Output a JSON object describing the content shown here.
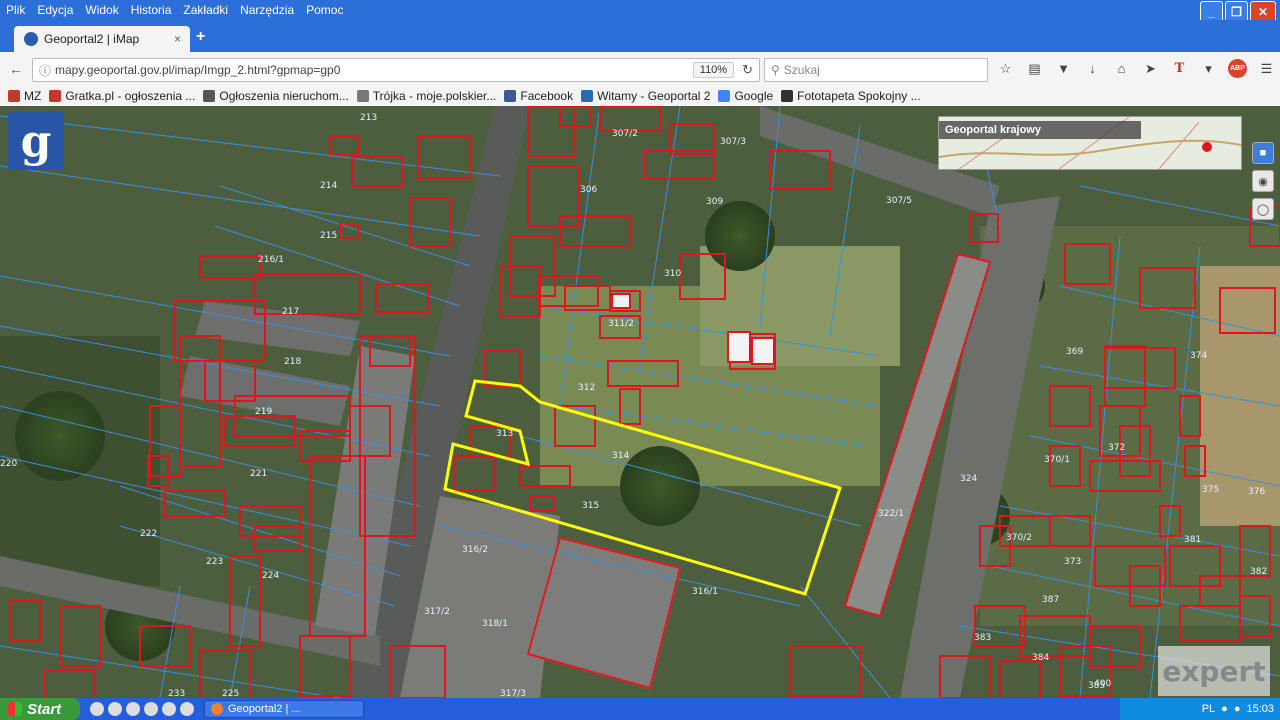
{
  "menu": [
    "Plik",
    "Edycja",
    "Widok",
    "Historia",
    "Zakładki",
    "Narzędzia",
    "Pomoc"
  ],
  "window_controls": {
    "minimize": "_",
    "maximize": "❐",
    "close": "✕"
  },
  "tab": {
    "title": "Geoportal2 | iMap",
    "close": "×",
    "new": "+"
  },
  "navbar": {
    "url": "mapy.geoportal.gov.pl/imap/Imgp_2.html?gpmap=gp0",
    "zoom": "110%",
    "search_placeholder": "Szukaj"
  },
  "bookmarks": [
    {
      "label": "MZ",
      "color": "#c0392b"
    },
    {
      "label": "Gratka.pl - ogłoszenia ...",
      "color": "#c0392b"
    },
    {
      "label": "Ogłoszenia nieruchom...",
      "color": "#555555"
    },
    {
      "label": "Trójka - moje.polskier...",
      "color": "#777777"
    },
    {
      "label": "Facebook",
      "color": "#3b5998"
    },
    {
      "label": "Witamy - Geoportal 2",
      "color": "#2a6ab0"
    },
    {
      "label": "Google",
      "color": "#4285f4"
    },
    {
      "label": "Fototapeta Spokojny ...",
      "color": "#333333"
    }
  ],
  "map": {
    "logo": "g",
    "minimap_title": "Geoportal krajowy",
    "watermark": "expert",
    "highlight_color": "#ffff00",
    "building_color": "#e0161e",
    "parcel_line_color": "#3b8fe0",
    "parcel_labels": [
      "213",
      "214",
      "215",
      "216/1",
      "217",
      "218",
      "219",
      "220",
      "221",
      "222",
      "223",
      "224",
      "225",
      "233",
      "306",
      "307/2",
      "307/3",
      "309",
      "310",
      "311/2",
      "312",
      "313",
      "314",
      "315",
      "316/1",
      "316/2",
      "317/2",
      "318/1",
      "322/1",
      "324",
      "307/5",
      "374",
      "369",
      "370/1",
      "372",
      "375",
      "376",
      "373",
      "370/2",
      "381",
      "382",
      "387",
      "383",
      "384",
      "385",
      "400",
      "317/3"
    ]
  },
  "taskbar": {
    "start": "Start",
    "task": "Geoportal2 | ...",
    "lang": "PL",
    "time": "15:03"
  }
}
